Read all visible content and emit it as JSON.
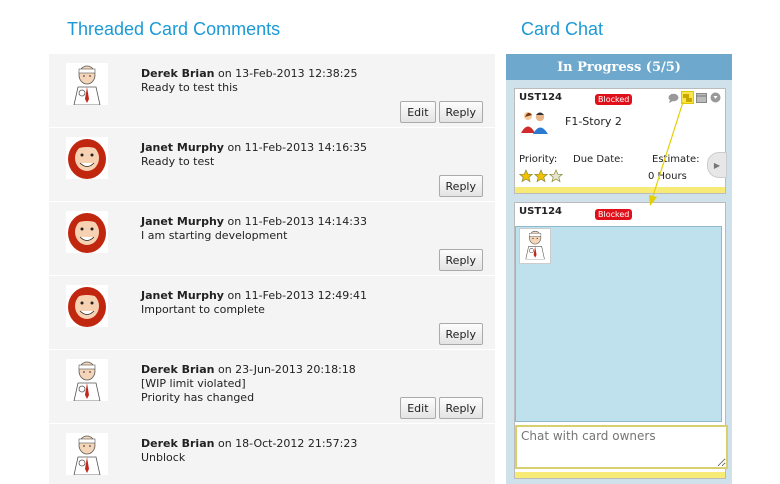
{
  "headings": {
    "left": "Threaded Card Comments",
    "right": "Card Chat"
  },
  "comments": [
    {
      "author": "Derek Brian",
      "meta": "on 13-Feb-2013 12:38:25",
      "lines": [
        "Ready to test this"
      ],
      "avatar": "derek",
      "buttons": [
        "Edit",
        "Reply"
      ]
    },
    {
      "author": "Janet Murphy",
      "meta": "on 11-Feb-2013 14:16:35",
      "lines": [
        "Ready to test"
      ],
      "avatar": "janet",
      "buttons": [
        "Reply"
      ]
    },
    {
      "author": "Janet Murphy",
      "meta": "on 11-Feb-2013 14:14:33",
      "lines": [
        "I am starting development"
      ],
      "avatar": "janet",
      "buttons": [
        "Reply"
      ]
    },
    {
      "author": "Janet Murphy",
      "meta": "on 11-Feb-2013 12:49:41",
      "lines": [
        "Important to complete"
      ],
      "avatar": "janet",
      "buttons": [
        "Reply"
      ]
    },
    {
      "author": "Derek Brian",
      "meta": "on 23-Jun-2013 20:18:18",
      "lines": [
        "[WIP limit violated]",
        "Priority has changed"
      ],
      "avatar": "derek",
      "buttons": [
        "Edit",
        "Reply"
      ]
    },
    {
      "author": "Derek Brian",
      "meta": "on 18-Oct-2012 21:57:23",
      "lines": [
        "Unblock"
      ],
      "avatar": "derek",
      "buttons": []
    }
  ],
  "chat": {
    "lane_title": "In Progress (5/5)",
    "card": {
      "id": "UST124",
      "badge": "Blocked",
      "title": "F1-Story 2",
      "priority_label": "Priority:",
      "due_label": "Due Date:",
      "estimate_label": "Estimate:",
      "estimate_value": "0 Hours",
      "stars_filled": 2,
      "stars_total": 3
    },
    "chat_card": {
      "id": "UST124",
      "badge": "Blocked"
    },
    "input_placeholder": "Chat with card owners"
  },
  "colors": {
    "heading": "#1a9ad6",
    "lane": "#6fa8cd",
    "badge": "#e0101a",
    "chat_area": "#bfe1ee",
    "star": "#f2c200"
  }
}
